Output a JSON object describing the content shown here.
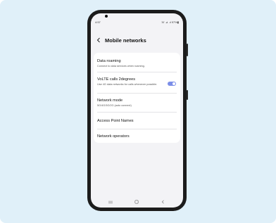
{
  "status_bar": {
    "time": "4:57",
    "icons": "☏ ⊿ .ıl 97%▮"
  },
  "header": {
    "title": "Mobile networks"
  },
  "settings": [
    {
      "label": "Data roaming",
      "sub": "Connect to data services when roaming."
    },
    {
      "label": "VoLTE calls 2degrees",
      "sub": "Use 4G data networks for calls whenever possible.",
      "toggle": true
    },
    {
      "label": "Network mode",
      "sub": "5G/4G/3G/2G (auto connect)"
    },
    {
      "label": "Access Point Names"
    },
    {
      "label": "Network operators"
    }
  ],
  "colors": {
    "accent": "#7b8ee8",
    "background": "#e0f0f9"
  },
  "icons": {
    "back": "chevron-left-icon",
    "recent": "recent-apps-icon",
    "home": "home-icon",
    "nav_back": "back-icon"
  }
}
